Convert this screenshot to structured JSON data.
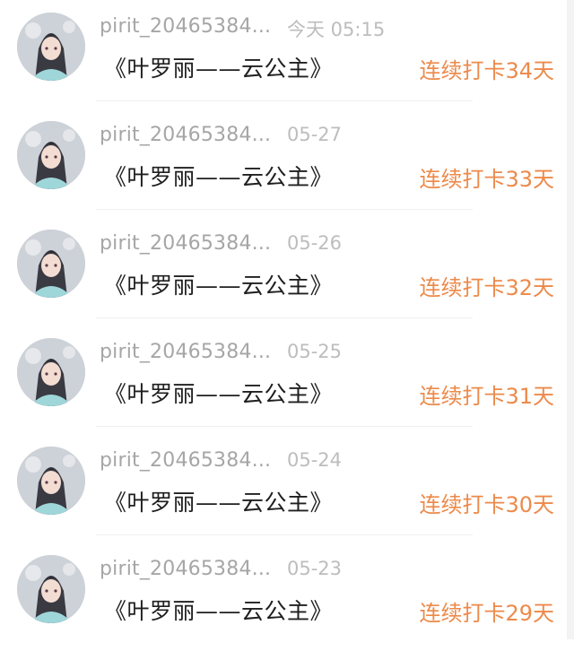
{
  "colors": {
    "username": "#a6a6a6",
    "date": "#bdbdbd",
    "title": "#1f1f1f",
    "checkin_accent": "#ec8a4b",
    "divider": "#f0f0f0"
  },
  "feed": {
    "items": [
      {
        "avatar_icon": "user-avatar-icon",
        "username": "pirit_20465384...",
        "date": "今天 05:15",
        "title": "《叶罗丽——云公主》",
        "checkin": "连续打卡34天"
      },
      {
        "avatar_icon": "user-avatar-icon",
        "username": "pirit_20465384...",
        "date": "05-27",
        "title": "《叶罗丽——云公主》",
        "checkin": "连续打卡33天"
      },
      {
        "avatar_icon": "user-avatar-icon",
        "username": "pirit_20465384...",
        "date": "05-26",
        "title": "《叶罗丽——云公主》",
        "checkin": "连续打卡32天"
      },
      {
        "avatar_icon": "user-avatar-icon",
        "username": "pirit_20465384...",
        "date": "05-25",
        "title": "《叶罗丽——云公主》",
        "checkin": "连续打卡31天"
      },
      {
        "avatar_icon": "user-avatar-icon",
        "username": "pirit_20465384...",
        "date": "05-24",
        "title": "《叶罗丽——云公主》",
        "checkin": "连续打卡30天"
      },
      {
        "avatar_icon": "user-avatar-icon",
        "username": "pirit_20465384...",
        "date": "05-23",
        "title": "《叶罗丽——云公主》",
        "checkin": "连续打卡29天"
      }
    ]
  }
}
